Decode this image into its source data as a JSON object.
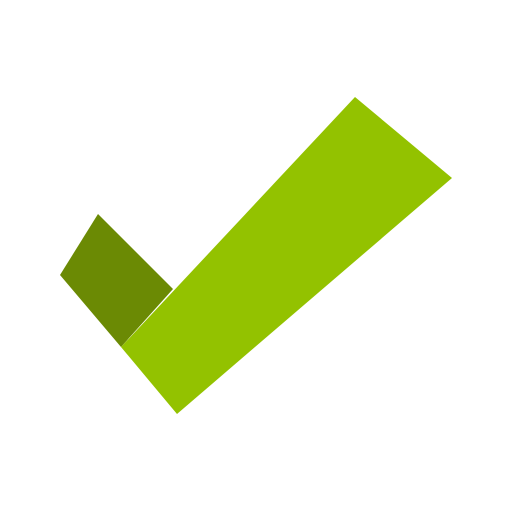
{
  "logo": {
    "icon": "checkmark-icon",
    "colors": {
      "background": "#ffffff",
      "short_stroke": "#6b8a04",
      "long_stroke": "#93c200"
    }
  }
}
